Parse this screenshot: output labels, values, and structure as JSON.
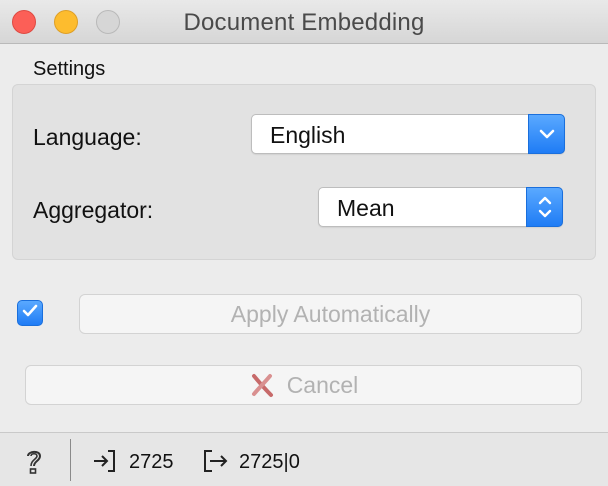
{
  "window": {
    "title": "Document Embedding"
  },
  "settings": {
    "group_label": "Settings",
    "language": {
      "label": "Language:",
      "value": "English"
    },
    "aggregator": {
      "label": "Aggregator:",
      "value": "Mean"
    }
  },
  "controls": {
    "apply_automatically_checked": true,
    "apply_label": "Apply Automatically",
    "cancel_label": "Cancel"
  },
  "status_bar": {
    "input_count": "2725",
    "output_count": "2725|0"
  },
  "icons": {
    "help": "question-mark-icon",
    "input": "input-arrow-icon",
    "output": "output-arrow-icon",
    "cancel": "x-mark-icon",
    "checkbox": "checkmark-icon",
    "dropdown": "chevron-down-icon",
    "stepper": "up-down-chevron-icon"
  },
  "colors": {
    "accent": "#1f7cf5",
    "close": "#fc5f57",
    "minimize": "#fdbc2e",
    "zoom": "#d6d6d6",
    "disabled_text": "#b2b2b2",
    "cancel_icon": "#c76a6a"
  }
}
